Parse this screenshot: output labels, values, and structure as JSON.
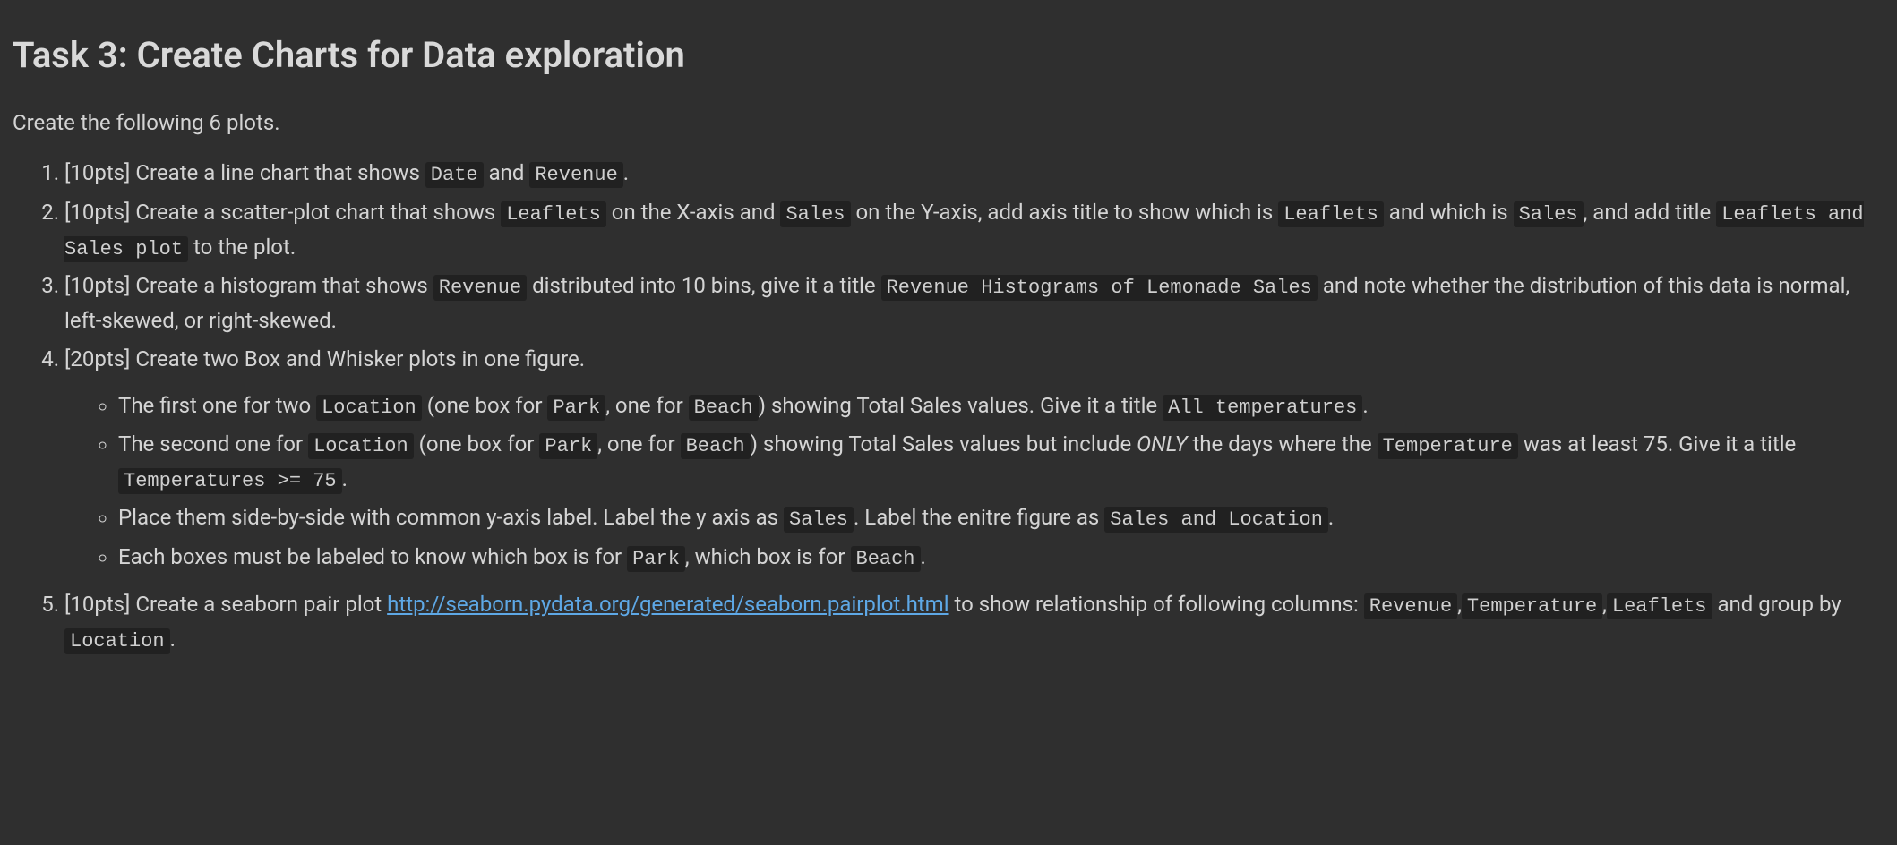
{
  "heading": "Task 3: Create Charts for Data exploration",
  "intro": "Create the following 6 plots.",
  "items": [
    {
      "pts": "[10pts] ",
      "t1": "Create a line chart that shows ",
      "c1": "Date",
      "t2": " and ",
      "c2": "Revenue",
      "t3": "."
    },
    {
      "pts": "[10pts] ",
      "t1": "Create a scatter-plot chart that shows ",
      "c1": "Leaflets",
      "t2": " on the X-axis and ",
      "c2": "Sales",
      "t3": " on the Y-axis, add axis title to show which is ",
      "c3": "Leaflets",
      "t4": " and which is ",
      "c4": "Sales",
      "t5": ", and add title ",
      "c5": "Leaflets and Sales plot",
      "t6": " to the plot."
    },
    {
      "pts": "[10pts] ",
      "t1": "Create a histogram that shows ",
      "c1": "Revenue",
      "t2": " distributed into 10 bins, give it a title ",
      "c2": "Revenue Histograms of Lemonade Sales",
      "t3": " and note whether the distribution of this data is normal, left-skewed, or right-skewed."
    },
    {
      "pts": "[20pts] ",
      "t1": "Create two Box and Whisker plots in one figure.",
      "sub": [
        {
          "s1": "The first one for two ",
          "c1": "Location",
          "s2": " (one box for ",
          "c2": "Park",
          "s3": ", one for ",
          "c3": "Beach",
          "s4": ") showing Total Sales values. Give it a title ",
          "c4": "All temperatures",
          "s5": "."
        },
        {
          "s1": "The second one for ",
          "c1": "Location",
          "s2": " (one box for ",
          "c2": "Park",
          "s3": ", one for ",
          "c3": "Beach",
          "s4": ") showing Total Sales values but include ",
          "em": "ONLY",
          "s5": " the days where the ",
          "c4": "Temperature",
          "s6": " was at least 75. Give it a title ",
          "c5": "Temperatures >= 75",
          "s7": "."
        },
        {
          "s1": "Place them side-by-side with common y-axis label. Label the y axis as ",
          "c1": "Sales",
          "s2": ". Label the enitre figure as ",
          "c2": "Sales and Location",
          "s3": "."
        },
        {
          "s1": "Each boxes must be labeled to know which box is for ",
          "c1": "Park",
          "s2": ", which box is for ",
          "c2": "Beach",
          "s3": "."
        }
      ]
    },
    {
      "pts": "[10pts] ",
      "t1": "Create a seaborn pair plot ",
      "link": "http://seaborn.pydata.org/generated/seaborn.pairplot.html",
      "t2": " to show relationship of following columns: ",
      "c1": "Revenue",
      "comma1": ",",
      "c2": "Temperature",
      "comma2": ",",
      "c3": "Leaflets",
      "t3": " and group by ",
      "c4": "Location",
      "t4": "."
    }
  ]
}
